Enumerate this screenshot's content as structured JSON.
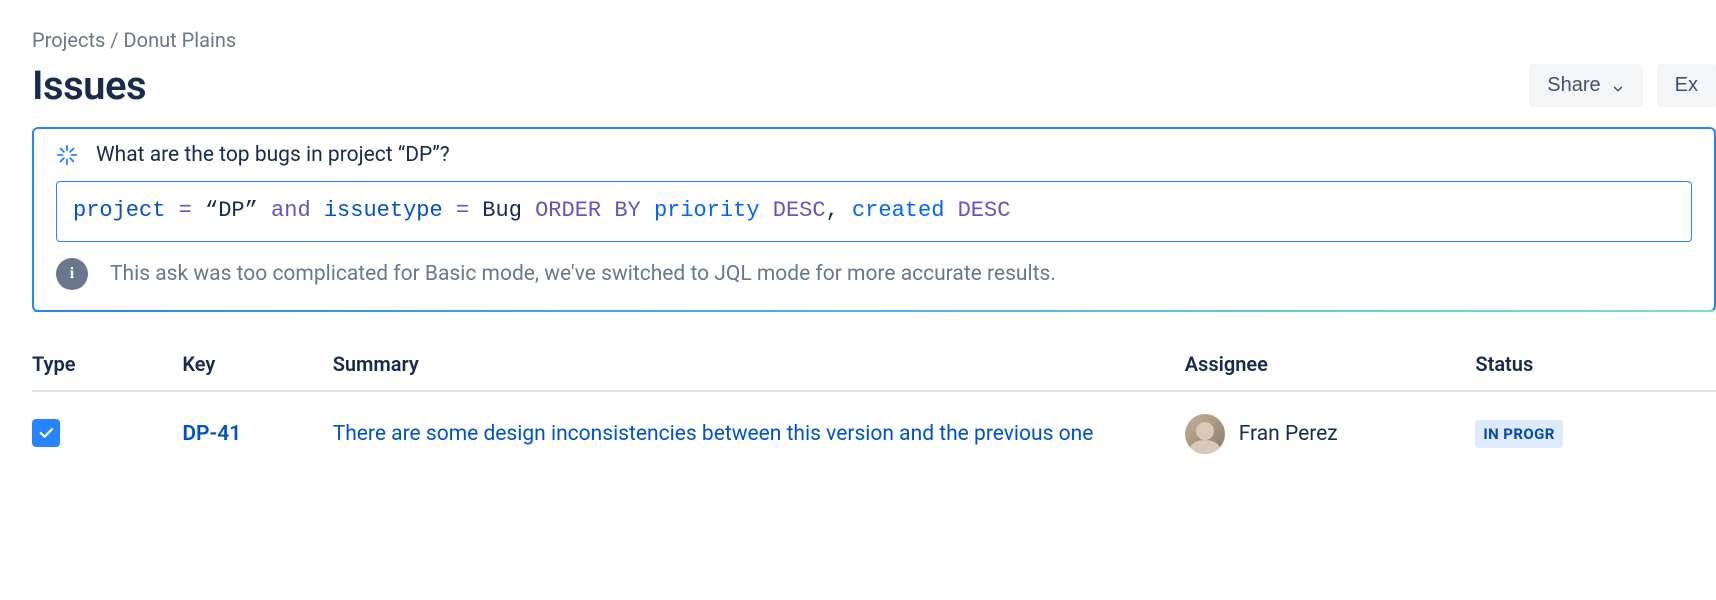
{
  "breadcrumb": {
    "root": "Projects",
    "sep": " / ",
    "project": "Donut Plains"
  },
  "page_title": "Issues",
  "actions": {
    "share_label": "Share",
    "export_label": "Ex"
  },
  "ai": {
    "question": "What are the top bugs in project “DP”?",
    "jql_tokens": [
      {
        "t": "project",
        "c": "tok-field"
      },
      {
        "t": " "
      },
      {
        "t": "=",
        "c": "tok-op"
      },
      {
        "t": " "
      },
      {
        "t": "“DP”",
        "c": "tok-str"
      },
      {
        "t": " "
      },
      {
        "t": "and",
        "c": "tok-kw"
      },
      {
        "t": " "
      },
      {
        "t": "issuetype",
        "c": "tok-field"
      },
      {
        "t": " "
      },
      {
        "t": "=",
        "c": "tok-op"
      },
      {
        "t": " "
      },
      {
        "t": "Bug",
        "c": "tok-val"
      },
      {
        "t": " "
      },
      {
        "t": "ORDER BY",
        "c": "tok-kw"
      },
      {
        "t": " "
      },
      {
        "t": "priority",
        "c": "tok-sort"
      },
      {
        "t": " "
      },
      {
        "t": "DESC",
        "c": "tok-kw"
      },
      {
        "t": ", "
      },
      {
        "t": "created",
        "c": "tok-sort"
      },
      {
        "t": " "
      },
      {
        "t": "DESC",
        "c": "tok-kw"
      }
    ],
    "info": "This ask was too complicated for Basic mode, we've switched to JQL mode for more accurate results."
  },
  "columns": {
    "type": "Type",
    "key": "Key",
    "summary": "Summary",
    "assignee": "Assignee",
    "status": "Status"
  },
  "rows": [
    {
      "key": "DP-41",
      "summary": "There are some design inconsistencies between this version and the previous one",
      "assignee": "Fran Perez",
      "status": "IN PROGR"
    }
  ]
}
